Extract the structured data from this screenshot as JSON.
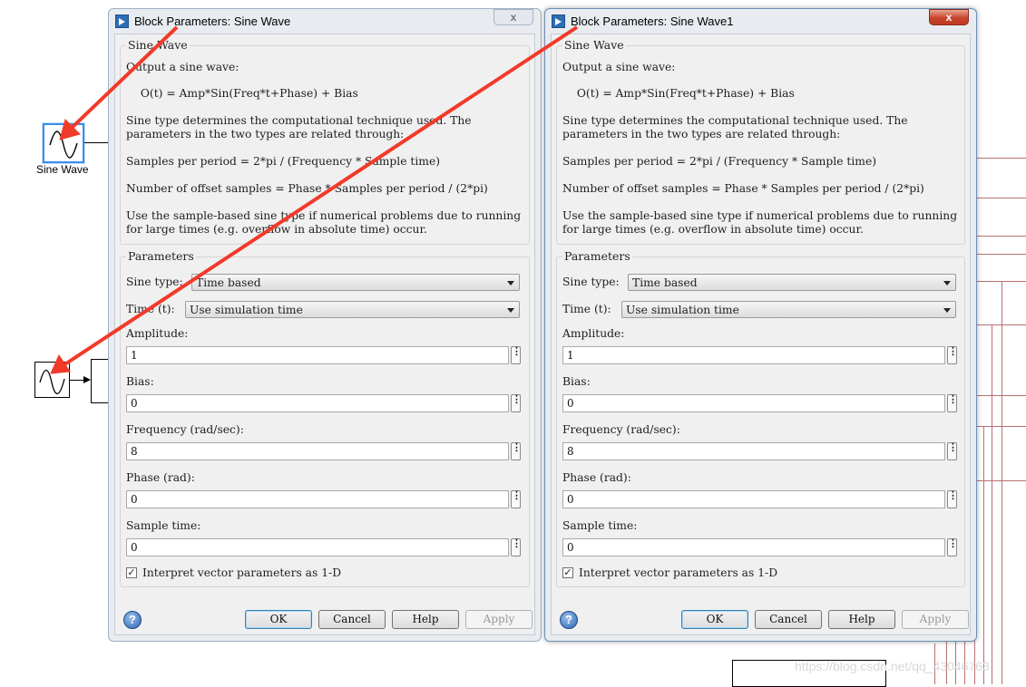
{
  "canvas": {
    "sine_block_label": "Sine Wave",
    "watermark": "https://blog.csdn.net/qq_43046763"
  },
  "dialogs": [
    {
      "title": "Block Parameters: Sine Wave",
      "close_label": "x",
      "description_group": "Sine Wave",
      "description": [
        "Output a sine wave:",
        "  O(t) = Amp*Sin(Freq*t+Phase) + Bias",
        "Sine type determines the computational technique used. The",
        "parameters in the two types are related through:",
        "Samples per period = 2*pi / (Frequency * Sample time)",
        "Number of offset samples = Phase * Samples per period / (2*pi)",
        "Use the sample-based sine type if numerical problems due to running",
        "for large times (e.g. overflow in absolute time) occur."
      ],
      "params_group": "Parameters",
      "sine_type": {
        "label": "Sine type:",
        "value": "Time based"
      },
      "time": {
        "label": "Time (t):",
        "value": "Use simulation time"
      },
      "fields": [
        {
          "label": "Amplitude:",
          "value": "1"
        },
        {
          "label": "Bias:",
          "value": "0"
        },
        {
          "label": "Frequency (rad/sec):",
          "value": "8"
        },
        {
          "label": "Phase (rad):",
          "value": "0"
        },
        {
          "label": "Sample time:",
          "value": "0"
        }
      ],
      "dots": "⋮",
      "interpret": {
        "label": "Interpret vector parameters as 1-D",
        "checked": true,
        "mark": "✓"
      },
      "help_icon": "?",
      "buttons": {
        "ok": "OK",
        "cancel": "Cancel",
        "help": "Help",
        "apply": "Apply"
      }
    },
    {
      "title": "Block Parameters: Sine Wave1",
      "close_label": "x",
      "description_group": "Sine Wave",
      "description": [
        "Output a sine wave:",
        "  O(t) = Amp*Sin(Freq*t+Phase) + Bias",
        "Sine type determines the computational technique used. The",
        "parameters in the two types are related through:",
        "Samples per period = 2*pi / (Frequency * Sample time)",
        "Number of offset samples = Phase * Samples per period / (2*pi)",
        "Use the sample-based sine type if numerical problems due to running",
        "for large times (e.g. overflow in absolute time) occur."
      ],
      "params_group": "Parameters",
      "sine_type": {
        "label": "Sine type:",
        "value": "Time based"
      },
      "time": {
        "label": "Time (t):",
        "value": "Use simulation time"
      },
      "fields": [
        {
          "label": "Amplitude:",
          "value": "1"
        },
        {
          "label": "Bias:",
          "value": "0"
        },
        {
          "label": "Frequency (rad/sec):",
          "value": "8"
        },
        {
          "label": "Phase (rad):",
          "value": "0"
        },
        {
          "label": "Sample time:",
          "value": "0"
        }
      ],
      "dots": "⋮",
      "interpret": {
        "label": "Interpret vector parameters as 1-D",
        "checked": true,
        "mark": "✓"
      },
      "help_icon": "?",
      "buttons": {
        "ok": "OK",
        "cancel": "Cancel",
        "help": "Help",
        "apply": "Apply"
      }
    }
  ],
  "colors": {
    "annotation_arrow": "#f23a2a",
    "close_active": "#c8442c"
  }
}
